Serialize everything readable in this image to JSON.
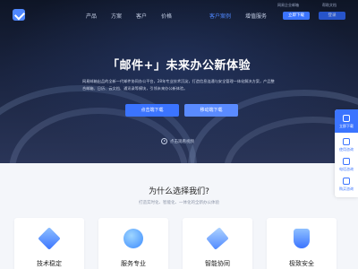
{
  "top_links": {
    "login": "网易企业邮箱",
    "help": "帮助文档"
  },
  "nav": {
    "items": [
      {
        "label": "产品"
      },
      {
        "label": "方案"
      },
      {
        "label": "客户"
      },
      {
        "label": "价格"
      },
      {
        "label": "客户案例"
      },
      {
        "label": "增值服务"
      }
    ],
    "active_index": 4,
    "trial_button": "立即下载",
    "login_button": "登录"
  },
  "hero": {
    "title": "「邮件+」未来办公新体验",
    "description": "网易邮箱出品的全新一代邮件协同办公平台，28年专业技术沉淀，打造信息连通与安全管理一体化解决方案，产品整合邮箱、日历、云文档、通讯录等模块，引领未来办公新体验。",
    "pc_download": "点击端下载",
    "mobile_download": "移动端下载",
    "video": "点击观看视频"
  },
  "float_bar": {
    "items": [
      {
        "label": "立即下载",
        "icon": "download-icon"
      },
      {
        "label": "使用咨询",
        "icon": "chat-icon"
      },
      {
        "label": "电话咨询",
        "icon": "phone-icon"
      },
      {
        "label": "购买咨询",
        "icon": "cart-icon"
      }
    ]
  },
  "why": {
    "title": "为什么选择我们?",
    "subtitle": "打造实时化、智能化、一体化的全新办公体验"
  },
  "cards": [
    {
      "label": "技术稳定",
      "icon": "stable-gem-icon"
    },
    {
      "label": "服务专业",
      "icon": "service-bubble-icon"
    },
    {
      "label": "智能协同",
      "icon": "layers-icon"
    },
    {
      "label": "极致安全",
      "icon": "shield-icon"
    }
  ],
  "colors": {
    "accent": "#3b74ff",
    "hero_bg": "#1a2440"
  }
}
